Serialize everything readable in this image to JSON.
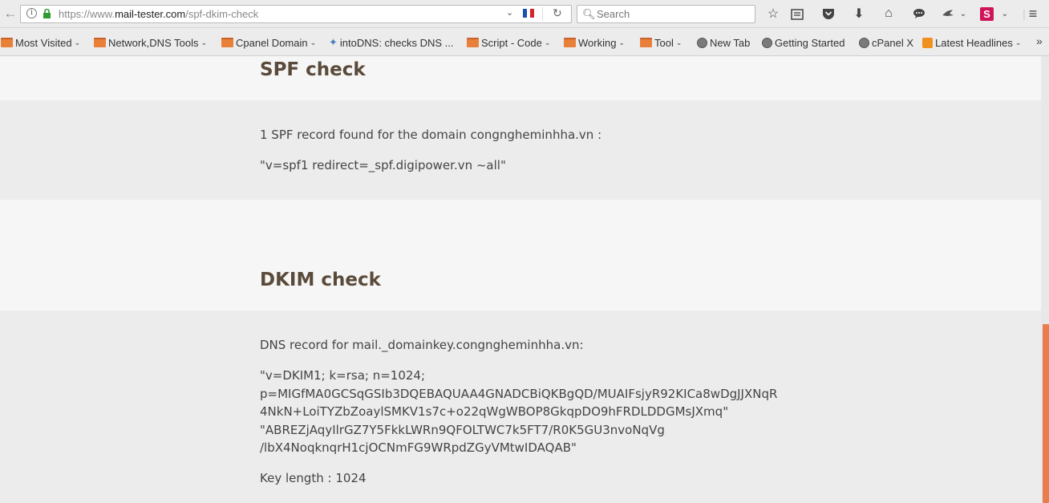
{
  "browser": {
    "url_prefix": "https://www.",
    "url_domain": "mail-tester.com",
    "url_path": "/spf-dkim-check",
    "search_placeholder": "Search"
  },
  "bookmarks": [
    {
      "label": "Most Visited",
      "icon": "gear-icon",
      "dropdown": true
    },
    {
      "label": "Network,DNS Tools",
      "icon": "folder-icon",
      "dropdown": true
    },
    {
      "label": "Cpanel Domain",
      "icon": "folder-icon",
      "dropdown": true
    },
    {
      "label": "intoDNS: checks DNS ...",
      "icon": "puzzle-icon",
      "dropdown": false
    },
    {
      "label": "Script - Code",
      "icon": "folder-icon",
      "dropdown": true
    },
    {
      "label": "Working",
      "icon": "folder-icon",
      "dropdown": true
    },
    {
      "label": "Tool",
      "icon": "folder-icon",
      "dropdown": true
    },
    {
      "label": "New Tab",
      "icon": "globe-icon",
      "dropdown": false
    },
    {
      "label": "Getting Started",
      "icon": "globe-icon",
      "dropdown": false
    },
    {
      "label": "cPanel X",
      "icon": "globe-icon",
      "dropdown": false
    },
    {
      "label": "Latest Headlines",
      "icon": "rss-icon",
      "dropdown": true
    }
  ],
  "spf": {
    "heading": "SPF check",
    "found_text": "1 SPF record found for the domain congngheminhha.vn :",
    "record": "\"v=spf1 redirect=_spf.digipower.vn ~all\""
  },
  "dkim": {
    "heading": "DKIM check",
    "record_label": "DNS record for mail._domainkey.congngheminhha.vn:",
    "record_lines": [
      "\"v=DKIM1; k=rsa; n=1024;",
      "p=MIGfMA0GCSqGSIb3DQEBAQUAA4GNADCBiQKBgQD/MUAIFsjyR92KICa8wDgJJXNqR",
      "4NkN+LoiTYZbZoaylSMKV1s7c+o22qWgWBOP8GkqpDO9hFRDLDDGMsJXmq\"",
      "\"ABREZjAqyIlrGZ7Y5FkkLWRn9QFOLTWC7k5FT7/R0K5GU3nvoNqVg",
      "/lbX4NoqknqrH1cjOCNmFG9WRpdZGyVMtwIDAQAB\""
    ],
    "key_length": "Key length : 1024"
  }
}
